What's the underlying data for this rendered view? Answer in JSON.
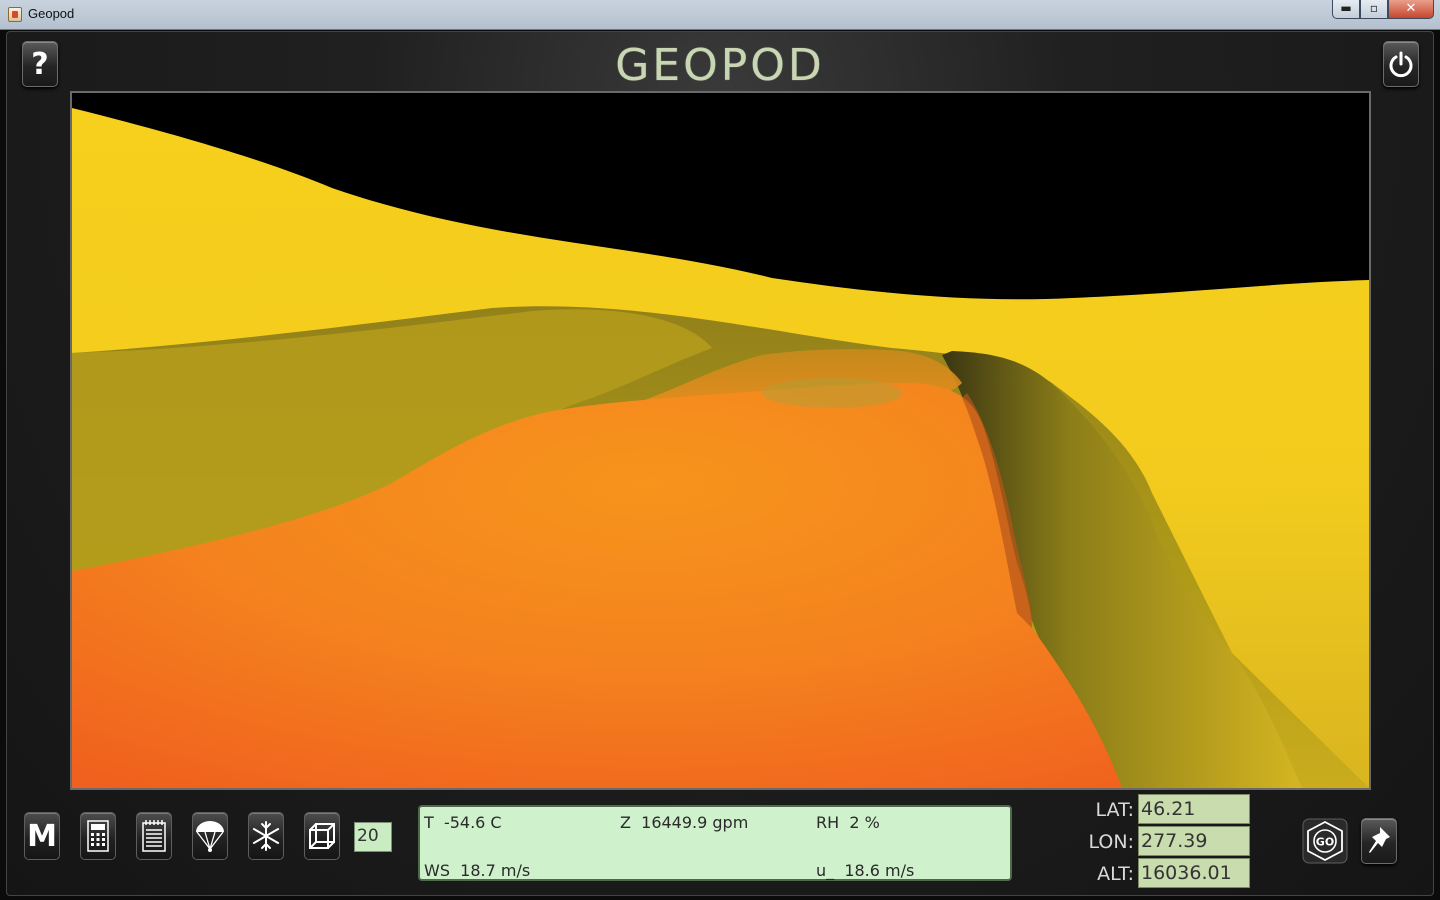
{
  "window": {
    "title": "Geopod",
    "minimize_glyph": "▬",
    "maximize_glyph": "▫",
    "close_glyph": "✕"
  },
  "header": {
    "logo": "GEOPOD",
    "help_glyph": "?"
  },
  "toolbar": {
    "menu_glyph": "M",
    "count_value": "20",
    "icons": [
      "menu-icon",
      "calculator-icon",
      "notepad-icon",
      "parachute-icon",
      "snowflake-icon",
      "cube-icon"
    ]
  },
  "readout": {
    "temperature": "T  -54.6 C",
    "geopotential": "Z  16449.9 gpm",
    "humidity": "RH  2 %",
    "wind_speed": "WS  18.7 m/s",
    "u_wind": "u_  18.6 m/s"
  },
  "position": {
    "lat_label": "LAT:",
    "lat_value": "46.21",
    "lon_label": "LON:",
    "lon_value": "277.39",
    "alt_label": "ALT:",
    "alt_value": "16036.01"
  },
  "go_button": {
    "label": "GO"
  },
  "colors": {
    "readout_bg": "#cff2cc",
    "coord_bg": "#c9dcae",
    "logo": "#c9d6b3",
    "surface_yellow": "#f4cf1c",
    "surface_orange": "#f5841f"
  }
}
